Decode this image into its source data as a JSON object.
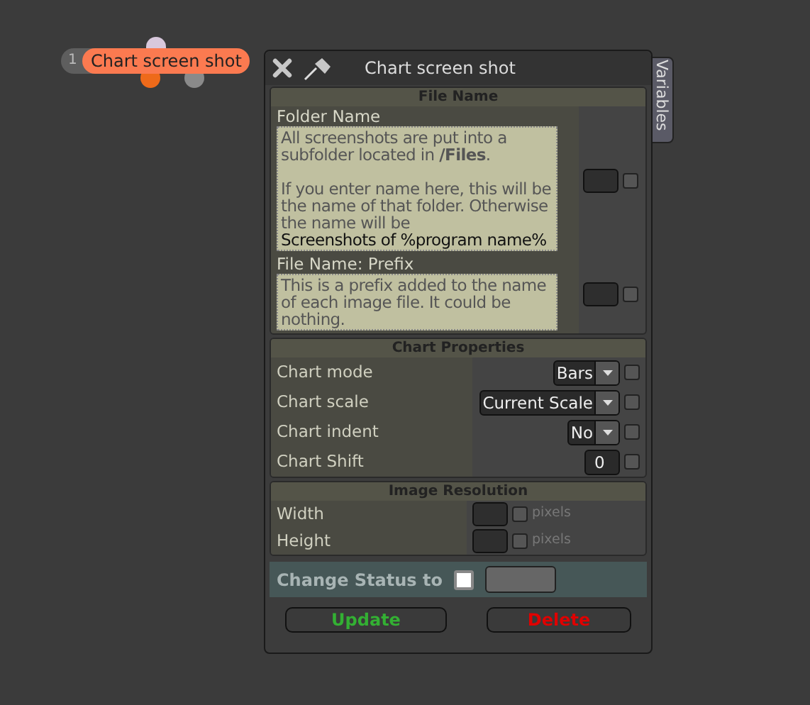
{
  "node": {
    "badge": "1",
    "label": "Chart screen shot"
  },
  "window": {
    "title": "Chart screen shot"
  },
  "side_tab": "Variables",
  "file_name": {
    "title": "File Name",
    "fields": [
      {
        "label": "Folder Name",
        "paragraphs": [
          {
            "text": "All screenshots are put into a subfolder located in **/Files**.",
            "emphasis": false
          },
          {
            "text": "If you enter name here, this will be the name of that folder. Otherwise the name will be",
            "emphasis": false
          },
          {
            "text": "Screenshots of %program name%",
            "emphasis": true
          }
        ],
        "checked": false
      },
      {
        "label": "File Name: Prefix",
        "paragraphs": [
          {
            "text": "This is a prefix added to the name of each image file. It could be nothing.",
            "emphasis": false
          }
        ],
        "checked": false
      }
    ]
  },
  "chart_properties": {
    "title": "Chart Properties",
    "rows": [
      {
        "label": "Chart mode",
        "kind": "select",
        "value": "Bars",
        "checked": false
      },
      {
        "label": "Chart scale",
        "kind": "select",
        "value": "Current Scale",
        "checked": false
      },
      {
        "label": "Chart indent",
        "kind": "select",
        "value": "No",
        "checked": false
      },
      {
        "label": "Chart Shift",
        "kind": "number",
        "value": "0",
        "checked": false
      }
    ]
  },
  "image_resolution": {
    "title": "Image Resolution",
    "rows": [
      {
        "label": "Width",
        "unit": "pixels",
        "checked": false
      },
      {
        "label": "Height",
        "unit": "pixels",
        "checked": false
      }
    ]
  },
  "status": {
    "label": "Change Status to",
    "checked": false
  },
  "buttons": [
    {
      "label": "Update",
      "kind": "confirm"
    },
    {
      "label": "Delete",
      "kind": "danger"
    }
  ]
}
